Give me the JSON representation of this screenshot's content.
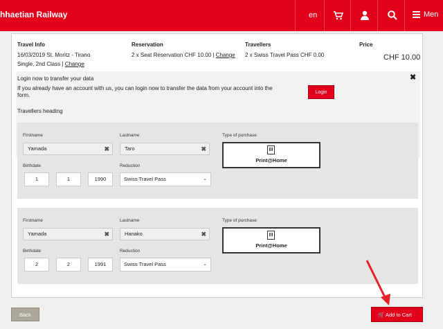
{
  "header": {
    "brand": "hhaetian Railway",
    "lang": "en",
    "menu_label": "Men",
    "icons": [
      "cart-icon",
      "user-icon",
      "search-icon",
      "menu-icon"
    ]
  },
  "summary": {
    "travel_info_heading": "Travel Info",
    "travel_line1": "16/03/2019 St. Moritz - Tirano",
    "travel_line2": "Single, 2nd Class |",
    "travel_change": "Change",
    "reservation_heading": "Reservation",
    "reservation_line": "2 x Seat Reservation CHF 10.00 |",
    "reservation_change": "Change",
    "travellers_heading": "Travellers",
    "travellers_line": "2 x Swiss Travel Pass CHF 0.00",
    "price_heading": "Price",
    "price_value": "CHF 10.00"
  },
  "login": {
    "title": "Login now to transfer your data",
    "description": "If you already have an account with us, you can login now to transfer the data from your account into the form.",
    "button": "Login",
    "close": "✖"
  },
  "travellers_heading": "Travellers heading",
  "labels": {
    "firstname": "Firstname",
    "lastname": "Lastname",
    "birthdate": "Birthdate",
    "reduction": "Reduction",
    "type_of_purchase": "Type of purchase"
  },
  "travellers": [
    {
      "firstname": "Yamada",
      "lastname": "Taro",
      "birth_day": "1",
      "birth_month": "1",
      "birth_year": "1990",
      "reduction": "Swiss Travel Pass",
      "purchase": "Print@Home"
    },
    {
      "firstname": "Yamada",
      "lastname": "Hanako",
      "birth_day": "2",
      "birth_month": "2",
      "birth_year": "1991",
      "reduction": "Swiss Travel Pass",
      "purchase": "Print@Home"
    }
  ],
  "footer": {
    "back": "Back",
    "add_to_cart": "Add to Cart"
  },
  "colors": {
    "brand_red": "#e2001a",
    "back_gray": "#aca899",
    "annotation_arrow": "#e8202a"
  }
}
